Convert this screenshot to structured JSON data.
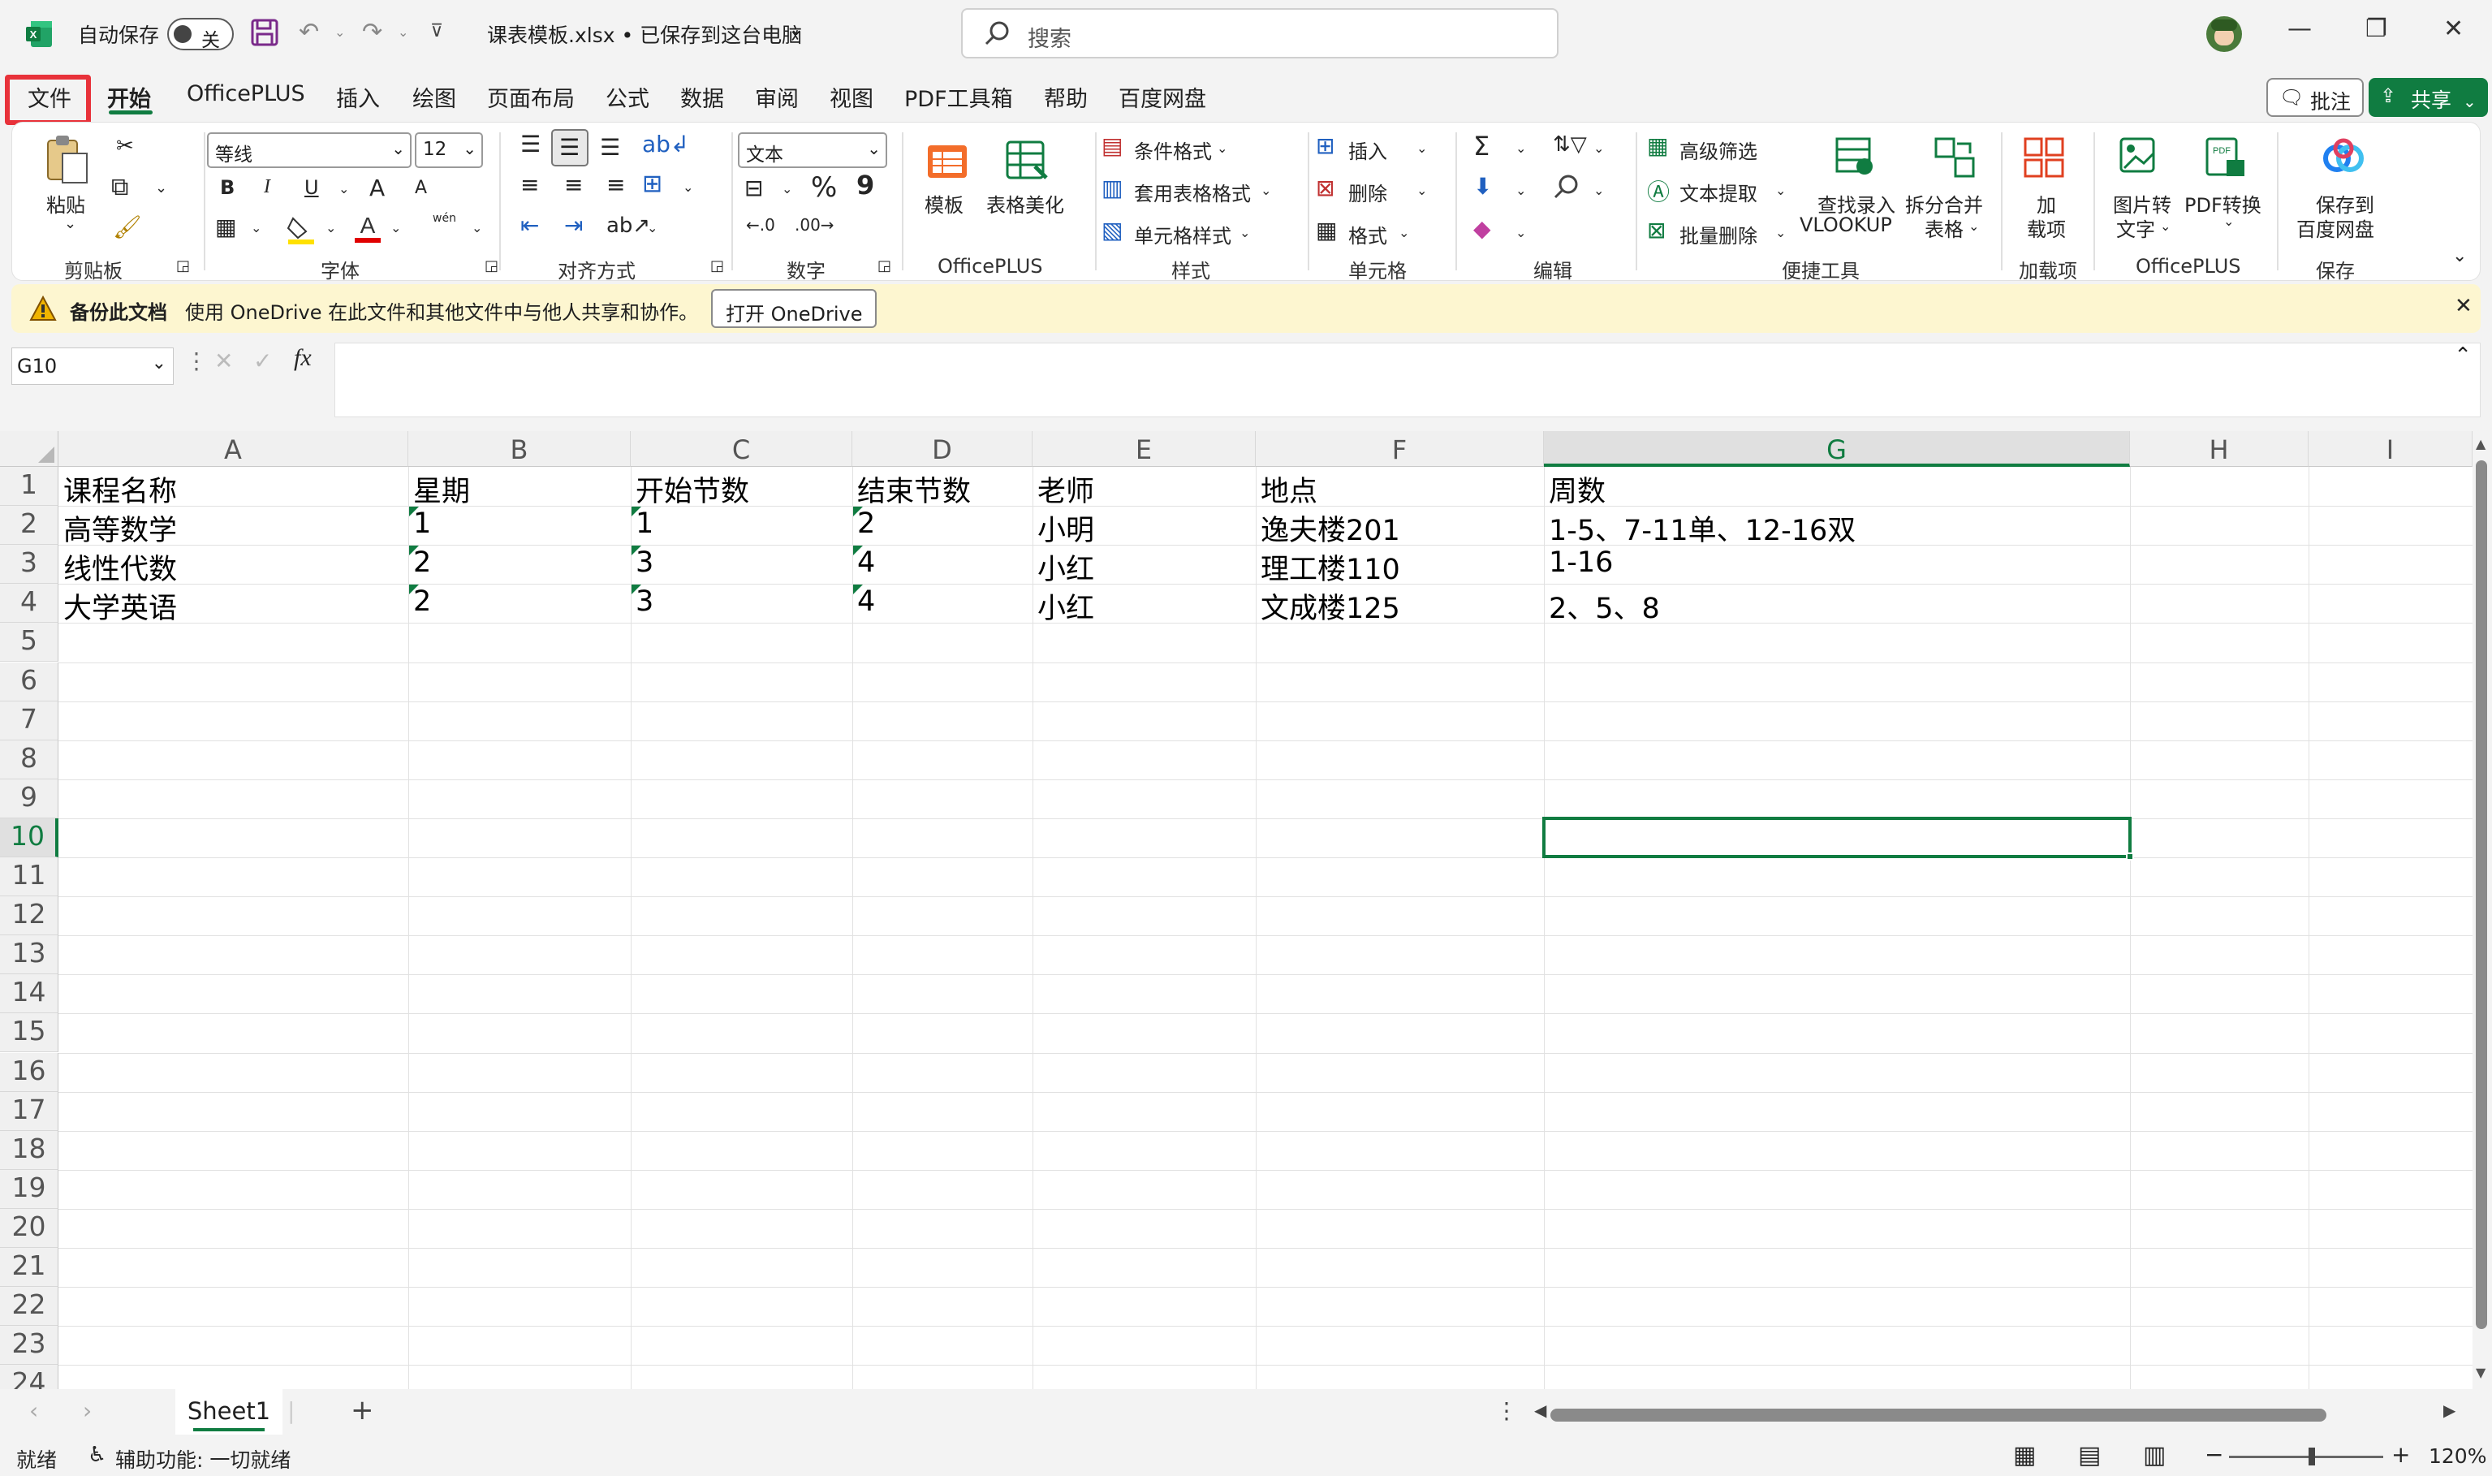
{
  "titlebar": {
    "autosave_label": "自动保存",
    "autosave_state": "关",
    "file_title": "课表模板.xlsx • 已保存到这台电脑",
    "search_placeholder": "搜索"
  },
  "tabs": [
    "文件",
    "开始",
    "OfficePLUS",
    "插入",
    "绘图",
    "页面布局",
    "公式",
    "数据",
    "审阅",
    "视图",
    "PDF工具箱",
    "帮助",
    "百度网盘"
  ],
  "active_tab": "开始",
  "actions": {
    "comment": "批注",
    "share": "共享"
  },
  "ribbon": {
    "clipboard": {
      "paste": "粘贴",
      "group": "剪贴板"
    },
    "font": {
      "family": "等线",
      "size": "12",
      "group": "字体",
      "bold": "B",
      "italic": "I",
      "underline": "U",
      "grow": "A",
      "shrink": "A",
      "phonetic": "wén"
    },
    "alignment": {
      "group": "对齐方式"
    },
    "number": {
      "format": "文本",
      "group": "数字",
      "percent": "%",
      "comma": "9"
    },
    "officeplus": {
      "template": "模板",
      "beautify": "表格美化",
      "group": "OfficePLUS"
    },
    "styles": {
      "conditional": "条件格式",
      "table_format": "套用表格格式",
      "cell_styles": "单元格样式",
      "group": "样式"
    },
    "cells": {
      "insert": "插入",
      "delete": "删除",
      "format": "格式",
      "group": "单元格"
    },
    "editing": {
      "group": "编辑"
    },
    "quick_tools": {
      "adv_filter": "高级筛选",
      "text_extract": "文本提取",
      "batch_delete": "批量删除",
      "vlookup_1": "查找录入",
      "vlookup_2": "VLOOKUP",
      "split_1": "拆分合并",
      "split_2": "表格",
      "group": "便捷工具"
    },
    "addins": {
      "label_1": "加",
      "label_2": "载项",
      "group": "加载项"
    },
    "officeplus2": {
      "img2text_1": "图片转",
      "img2text_2": "文字",
      "pdf_convert": "PDF转换",
      "group": "OfficePLUS"
    },
    "save": {
      "label_1": "保存到",
      "label_2": "百度网盘",
      "group": "保存"
    }
  },
  "notification": {
    "title": "备份此文档",
    "message": "使用 OneDrive 在此文件和其他文件中与他人共享和协作。",
    "button": "打开 OneDrive"
  },
  "formula_bar": {
    "name_box": "G10",
    "fx": "fx",
    "value": ""
  },
  "sheet": {
    "columns": [
      "A",
      "B",
      "C",
      "D",
      "E",
      "F",
      "G",
      "H",
      "I"
    ],
    "rows": [
      "1",
      "2",
      "3",
      "4",
      "5",
      "6",
      "7",
      "8",
      "9",
      "10",
      "11",
      "12",
      "13",
      "14",
      "15",
      "16",
      "17",
      "18",
      "19",
      "20",
      "21",
      "22",
      "23",
      "24"
    ],
    "cells": [
      [
        "课程名称",
        "星期",
        "开始节数",
        "结束节数",
        "老师",
        "地点",
        "周数"
      ],
      [
        "高等数学",
        "1",
        "1",
        "2",
        "小明",
        "逸夫楼201",
        "1-5、7-11单、12-16双"
      ],
      [
        "线性代数",
        "2",
        "3",
        "4",
        "小红",
        "理工楼110",
        "1-16"
      ],
      [
        "大学英语",
        "2",
        "3",
        "4",
        "小红",
        "文成楼125",
        "2、5、8"
      ]
    ],
    "selected_cell": "G10",
    "tab_name": "Sheet1"
  },
  "statusbar": {
    "ready": "就绪",
    "accessibility": "辅助功能: 一切就绪",
    "zoom": "120%"
  },
  "colors": {
    "accent": "#107c41",
    "highlight": "#e8323a"
  }
}
